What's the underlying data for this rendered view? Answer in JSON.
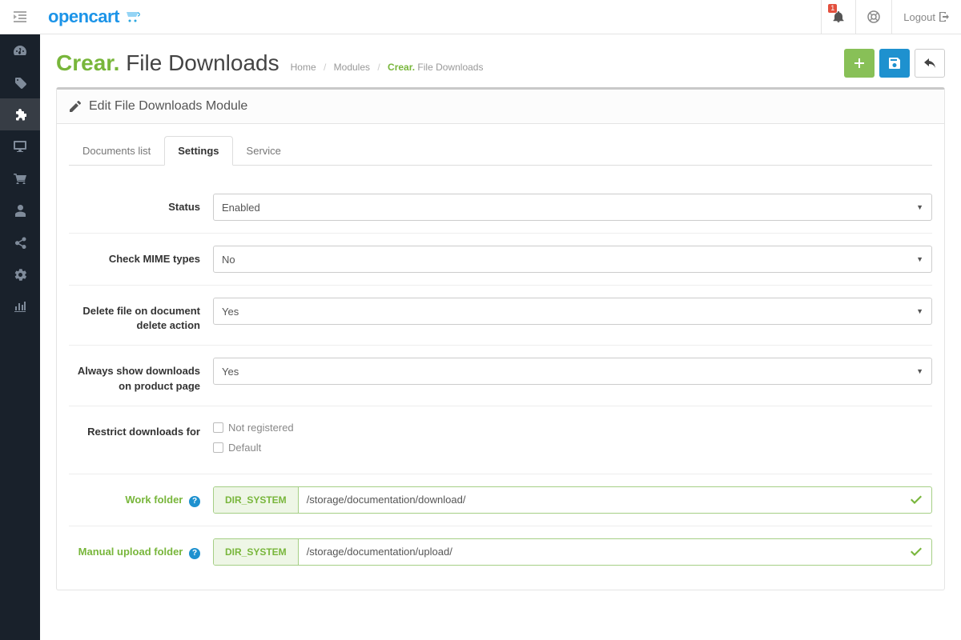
{
  "header": {
    "logo_text": "opencart",
    "notification_count": "1",
    "logout_label": "Logout"
  },
  "page": {
    "title_brand": "Crear.",
    "title_rest": "File Downloads"
  },
  "breadcrumb": {
    "home": "Home",
    "modules": "Modules",
    "current_brand": "Crear.",
    "current_rest": "File Downloads"
  },
  "panel": {
    "heading": "Edit File Downloads Module"
  },
  "tabs": {
    "documents": "Documents list",
    "settings": "Settings",
    "service": "Service"
  },
  "form": {
    "status_label": "Status",
    "status_value": "Enabled",
    "mime_label": "Check MIME types",
    "mime_value": "No",
    "delete_label": "Delete file on document delete action",
    "delete_value": "Yes",
    "always_show_label": "Always show downloads on product page",
    "always_show_value": "Yes",
    "restrict_label": "Restrict downloads for",
    "restrict_opt1": "Not registered",
    "restrict_opt2": "Default",
    "work_folder_label": "Work folder",
    "work_folder_prefix": "DIR_SYSTEM",
    "work_folder_value": "/storage/documentation/download/",
    "upload_folder_label": "Manual upload folder",
    "upload_folder_prefix": "DIR_SYSTEM",
    "upload_folder_value": "/storage/documentation/upload/"
  }
}
